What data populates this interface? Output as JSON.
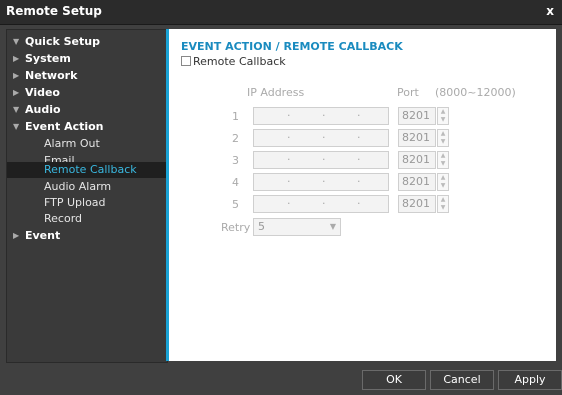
{
  "window": {
    "title": "Remote Setup",
    "close_label": "x"
  },
  "sidebar": {
    "sections": [
      {
        "label": "Quick Setup",
        "arrow": "▼"
      },
      {
        "label": "System",
        "arrow": "▶"
      },
      {
        "label": "Network",
        "arrow": "▶"
      },
      {
        "label": "Video",
        "arrow": "▶"
      },
      {
        "label": "Audio",
        "arrow": "▼"
      },
      {
        "label": "Event Action",
        "arrow": "▼"
      }
    ],
    "sub_items": [
      {
        "label": "Alarm Out"
      },
      {
        "label": "Email"
      },
      {
        "label": "Remote Callback"
      },
      {
        "label": "Audio Alarm"
      },
      {
        "label": "FTP Upload"
      },
      {
        "label": "Record"
      }
    ],
    "event": {
      "label": "Event",
      "arrow": "▶"
    },
    "selected": "Remote Callback"
  },
  "main": {
    "heading": "EVENT ACTION / REMOTE CALLBACK",
    "remote_callback_label": "Remote Callback",
    "remote_callback_checked": false,
    "ip_header": "IP Address",
    "port_header": "Port",
    "port_range": "(8000~12000)",
    "rows": [
      {
        "num": "1",
        "port": "8201"
      },
      {
        "num": "2",
        "port": "8201"
      },
      {
        "num": "3",
        "port": "8201"
      },
      {
        "num": "4",
        "port": "8201"
      },
      {
        "num": "5",
        "port": "8201"
      }
    ],
    "ip_dot": "·",
    "retry_label": "Retry",
    "retry_value": "5"
  },
  "footer": {
    "ok": "OK",
    "cancel": "Cancel",
    "apply": "Apply"
  }
}
